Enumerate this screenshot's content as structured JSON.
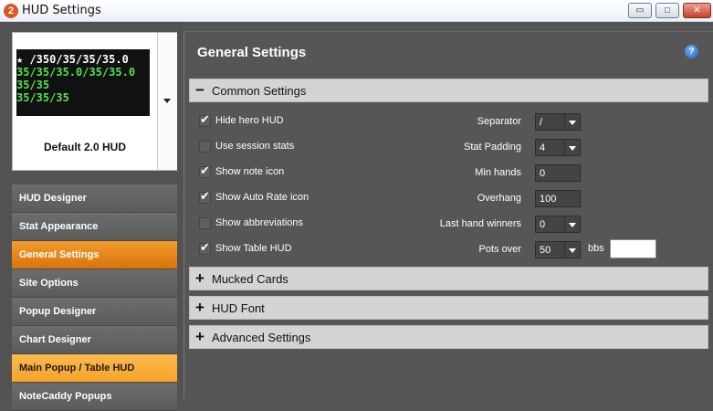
{
  "window": {
    "icon_text": "2",
    "title": "HUD Settings",
    "min_glyph": "▭",
    "max_glyph": "□",
    "close_glyph": "✕"
  },
  "hud_preview": {
    "name": "Default 2.0 HUD",
    "lines": [
      "★ /350/35/35/35.0",
      "35/35/35.0/35/35.0",
      "35/35",
      "35/35/35"
    ]
  },
  "nav": {
    "items": [
      {
        "label": "HUD Designer"
      },
      {
        "label": "Stat Appearance"
      },
      {
        "label": "General Settings"
      },
      {
        "label": "Site Options"
      },
      {
        "label": "Popup Designer"
      },
      {
        "label": "Chart Designer"
      },
      {
        "label": "Main Popup / Table HUD"
      },
      {
        "label": "NoteCaddy Popups"
      }
    ]
  },
  "main": {
    "title": "General Settings",
    "help_glyph": "?",
    "sections": {
      "common": {
        "sign": "−",
        "label": "Common Settings"
      },
      "mucked": {
        "sign": "+",
        "label": "Mucked Cards"
      },
      "font": {
        "sign": "+",
        "label": "HUD Font"
      },
      "advanced": {
        "sign": "+",
        "label": "Advanced Settings"
      }
    },
    "checkboxes": [
      {
        "label": "Hide hero HUD",
        "checked": true
      },
      {
        "label": "Use session stats",
        "checked": false
      },
      {
        "label": "Show note icon",
        "checked": true
      },
      {
        "label": "Show Auto Rate icon",
        "checked": true
      },
      {
        "label": "Show abbreviations",
        "checked": false
      },
      {
        "label": "Show Table HUD",
        "checked": true
      }
    ],
    "settings": {
      "separator": {
        "label": "Separator",
        "value": "/"
      },
      "stat_padding": {
        "label": "Stat Padding",
        "value": "4"
      },
      "min_hands": {
        "label": "Min hands",
        "value": "0"
      },
      "overhang": {
        "label": "Overhang",
        "value": "100"
      },
      "last_hand_winners": {
        "label": "Last hand winners",
        "value": "0"
      },
      "pots_over": {
        "label": "Pots over",
        "value": "50"
      },
      "bbs_label": "bbs",
      "bbs_value": ""
    }
  },
  "colors": {
    "nav_active": "#e5850f",
    "nav_highlight": "#f9ad3c",
    "panel_bg": "#565656",
    "section_header": "#d4d4d4"
  }
}
